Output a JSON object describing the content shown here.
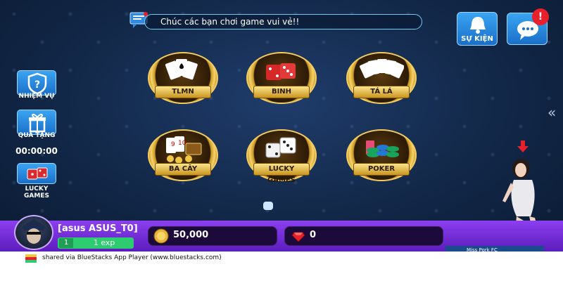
{
  "marquee": {
    "text": "Chúc các bạn chơi game vui vẻ!!",
    "icon": "chat-message-icon"
  },
  "top_right": {
    "event_label": "SỰ KIỆN",
    "event_icon": "bell-icon",
    "chat_icon": "chat-bubble-icon",
    "chat_badge": "!"
  },
  "sidebar": {
    "mission_label": "NHIỆM VỤ",
    "gift_label": "QUÀ TẶNG",
    "timer": "00:00:00",
    "lucky_label": "LUCKY GAMES"
  },
  "games": [
    {
      "label": "TLMN"
    },
    {
      "label": "BINH"
    },
    {
      "label": "TÁ LÁ"
    },
    {
      "label": "BA CÂY"
    },
    {
      "label": "LUCKY GAMES"
    },
    {
      "label": "POKER"
    }
  ],
  "collapse_arrow": "«",
  "user": {
    "name": "[asus ASUS_T0]",
    "level": "1",
    "exp": "1 exp",
    "coins": "50,000",
    "gems": "0"
  },
  "ad": {
    "text": "Miss Pork FC"
  },
  "footer": {
    "text": "shared via BlueStacks App Player (www.bluestacks.com)"
  },
  "colors": {
    "background": "#122848",
    "bottom_bar": "#7a2fe0",
    "accent_blue": "#2a8ee6",
    "gold": "#e6b53a"
  }
}
